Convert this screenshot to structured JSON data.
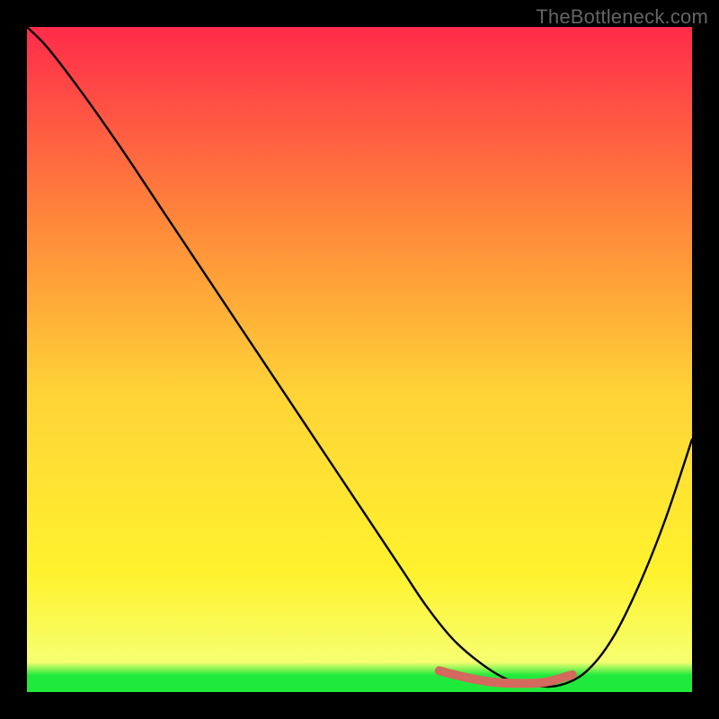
{
  "watermark": "TheBottleneck.com",
  "colors": {
    "gradient_top": "#ff2b4a",
    "gradient_mid_upper": "#ff8a3a",
    "gradient_mid": "#ffd337",
    "gradient_mid_lower": "#fff22d",
    "gradient_green": "#1fea3b",
    "curve": "#000000",
    "highlight": "#d4695e",
    "frame": "#000000"
  },
  "chart_data": {
    "type": "line",
    "title": "",
    "xlabel": "",
    "ylabel": "",
    "xlim": [
      0,
      100
    ],
    "ylim": [
      0,
      100
    ],
    "series": [
      {
        "name": "bottleneck-curve",
        "x": [
          0,
          3,
          8,
          14,
          20,
          26,
          32,
          38,
          44,
          50,
          56,
          60,
          64,
          68,
          72,
          76,
          80,
          84,
          88,
          92,
          96,
          100
        ],
        "values": [
          100,
          97,
          90.5,
          82,
          73,
          64,
          55,
          46,
          37,
          28,
          19,
          13,
          8,
          4.5,
          2,
          1,
          1,
          3,
          8,
          16,
          26,
          38
        ]
      }
    ],
    "highlight_band": {
      "name": "optimal-range",
      "x": [
        62,
        66,
        70,
        74,
        78,
        82
      ],
      "values": [
        3.2,
        2.2,
        1.5,
        1.3,
        1.5,
        2.6
      ]
    },
    "annotations": []
  }
}
